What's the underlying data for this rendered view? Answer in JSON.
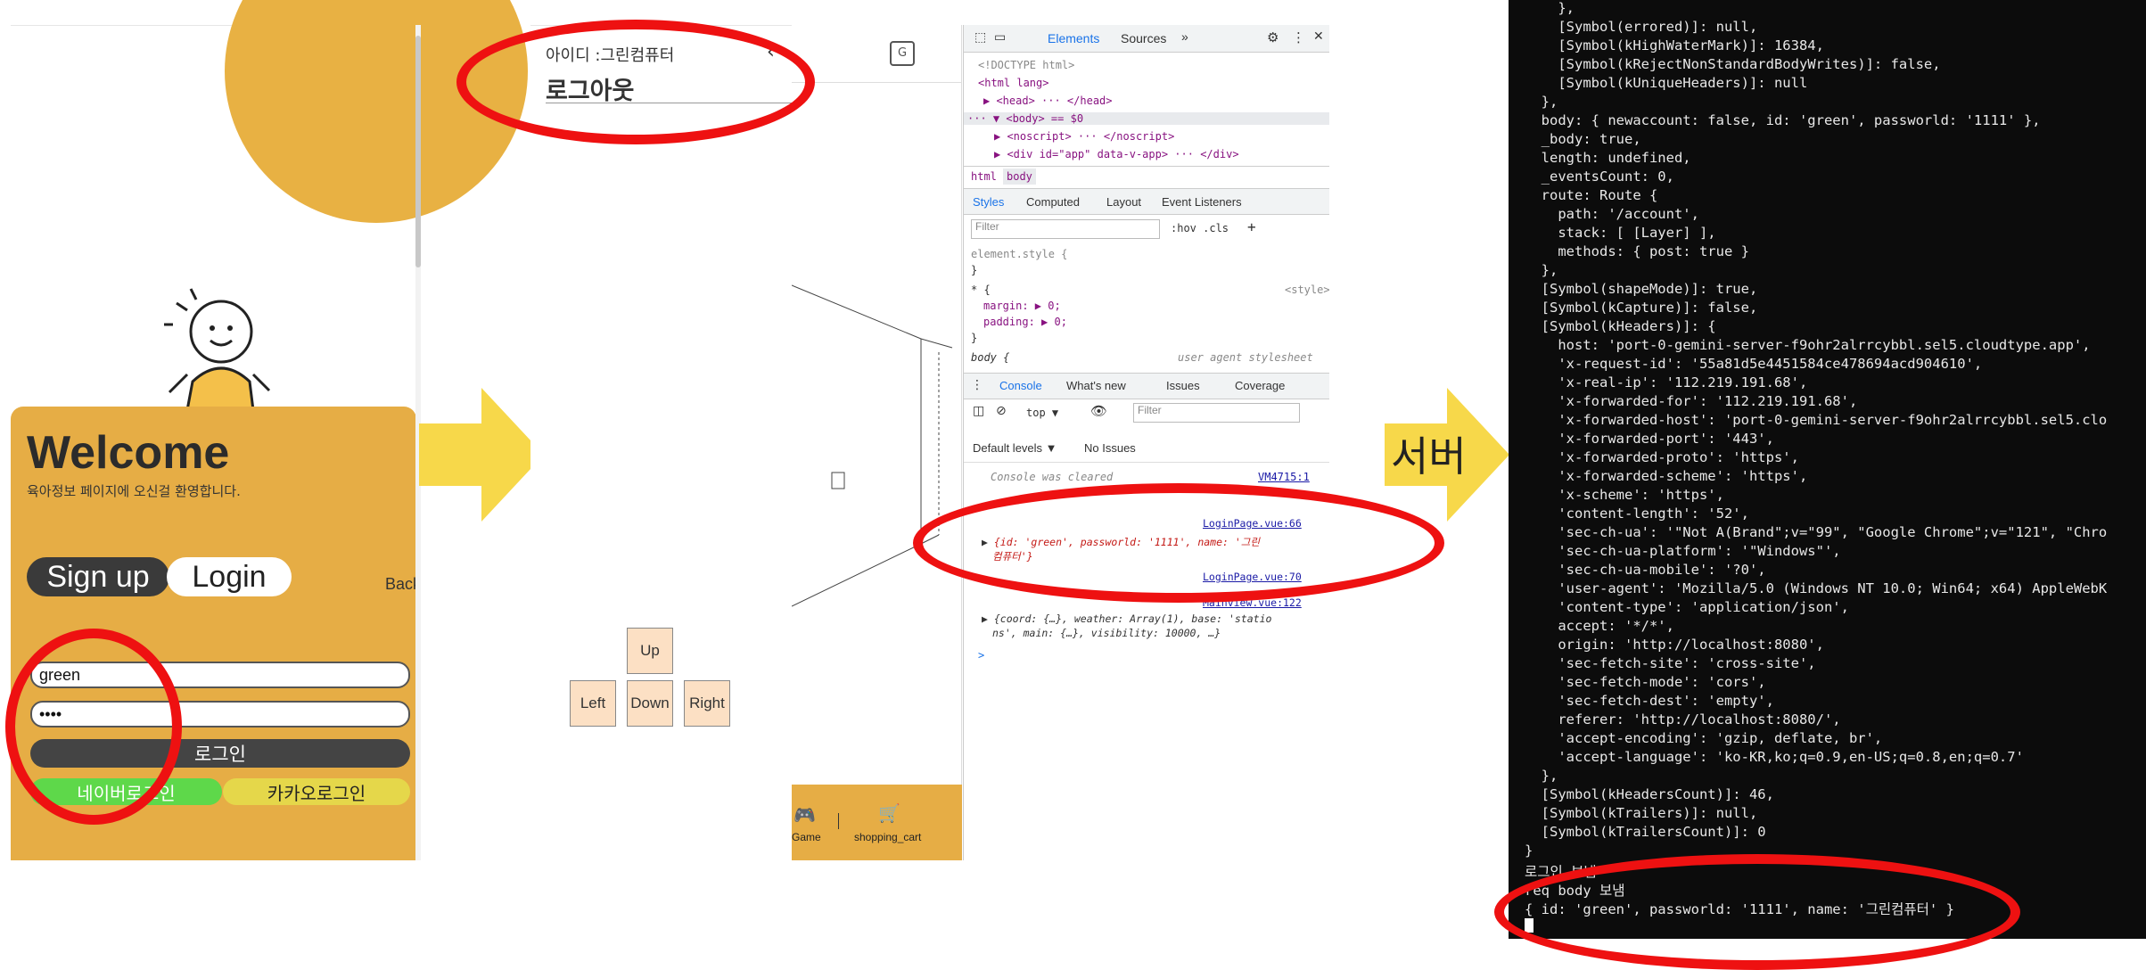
{
  "login_page": {
    "welcome_title": "Welcome",
    "welcome_subtitle": "육아정보 페이지에 오신걸 환영합니다.",
    "signup_tab": "Sign up",
    "login_tab": "Login",
    "back_partial": "Back",
    "id_value": "green",
    "password_masked": "••••",
    "login_button": "로그인",
    "naver_login": "네이버로그인",
    "kakao_login": "카카오로그인"
  },
  "app_page": {
    "user_label": "아이디 :그린컴퓨터",
    "logout": "로그아웃",
    "dpad": {
      "up": "Up",
      "left": "Left",
      "down": "Down",
      "right": "Right"
    },
    "footer": {
      "game": "Game",
      "cart": "shopping_cart"
    }
  },
  "devtools": {
    "tabs": [
      "Elements",
      "Sources"
    ],
    "dom": [
      "<!DOCTYPE html>",
      "<html lang>",
      "<head> ··· </head>",
      "<body> == $0",
      "<noscript> ··· </noscript>",
      "<div id=\"app\" data-v-app> ··· </div>"
    ],
    "crumbs": [
      "html",
      "body"
    ],
    "styles_tabs": [
      "Styles",
      "Computed",
      "Layout",
      "Event Listeners"
    ],
    "filter_placeholder": "Filter",
    "hov_cls": ":hov  .cls",
    "style_lines": [
      "element.style {",
      "}",
      "* {",
      "margin: ▶ 0;",
      "padding: ▶ 0;",
      "}",
      "body {"
    ],
    "style_source": "<style>",
    "ua_label": "user agent stylesheet",
    "console_tabs": [
      "Console",
      "What's new",
      "Issues",
      "Coverage"
    ],
    "context": "top ▼",
    "console_filter": "Filter",
    "levels": "Default levels ▼",
    "issues": "No Issues",
    "cleared": "Console was cleared",
    "cleared_src": "VM4715:1",
    "log1_src": "LoginPage.vue:66",
    "log1_text_a": "{id: 'green', passworld: '1111', name: '그린",
    "log1_text_b": "컴퓨터'}",
    "log2_src": "LoginPage.vue:70",
    "log3_src": "Mainview.vue:122",
    "log3_text_a": "{coord: {…}, weather: Array(1), base: 'statio",
    "log3_text_b": "ns', main: {…}, visibility: 10000, …}",
    "prompt": ">"
  },
  "server_label": "서버",
  "terminal": {
    "lines": [
      "    },",
      "    [Symbol(errored)]: null,",
      "    [Symbol(kHighWaterMark)]: 16384,",
      "    [Symbol(kRejectNonStandardBodyWrites)]: false,",
      "    [Symbol(kUniqueHeaders)]: null",
      "  },",
      "  body: { newaccount: false, id: 'green', passworld: '1111' },",
      "  _body: true,",
      "  length: undefined,",
      "  _eventsCount: 0,",
      "  route: Route {",
      "    path: '/account',",
      "    stack: [ [Layer] ],",
      "    methods: { post: true }",
      "  },",
      "  [Symbol(shapeMode)]: true,",
      "  [Symbol(kCapture)]: false,",
      "  [Symbol(kHeaders)]: {",
      "    host: 'port-0-gemini-server-f9ohr2alrrcybbl.sel5.cloudtype.app',",
      "    'x-request-id': '55a81d5e4451584ce478694acd904610',",
      "    'x-real-ip': '112.219.191.68',",
      "    'x-forwarded-for': '112.219.191.68',",
      "    'x-forwarded-host': 'port-0-gemini-server-f9ohr2alrrcybbl.sel5.clo",
      "    'x-forwarded-port': '443',",
      "    'x-forwarded-proto': 'https',",
      "    'x-forwarded-scheme': 'https',",
      "    'x-scheme': 'https',",
      "    'content-length': '52',",
      "    'sec-ch-ua': '\"Not A(Brand\";v=\"99\", \"Google Chrome\";v=\"121\", \"Chro",
      "    'sec-ch-ua-platform': '\"Windows\"',",
      "    'sec-ch-ua-mobile': '?0',",
      "    'user-agent': 'Mozilla/5.0 (Windows NT 10.0; Win64; x64) AppleWebK",
      "    'content-type': 'application/json',",
      "    accept: '*/*',",
      "    origin: 'http://localhost:8080',",
      "    'sec-fetch-site': 'cross-site',",
      "    'sec-fetch-mode': 'cors',",
      "    'sec-fetch-dest': 'empty',",
      "    referer: 'http://localhost:8080/',",
      "    'accept-encoding': 'gzip, deflate, br',",
      "    'accept-language': 'ko-KR,ko;q=0.9,en-US;q=0.8,en;q=0.7'",
      "  },",
      "  [Symbol(kHeadersCount)]: 46,",
      "  [Symbol(kTrailers)]: null,",
      "  [Symbol(kTrailersCount)]: 0",
      "}",
      "로그인 보냄",
      "req body 보냄",
      "{ id: 'green', passworld: '1111', name: '그린컴퓨터' }"
    ]
  },
  "colors": {
    "accent_orange": "#e6ad45",
    "arrow_yellow": "#f7d84a",
    "highlight_red": "#ee1111",
    "terminal_bg": "#0c0c0c"
  }
}
